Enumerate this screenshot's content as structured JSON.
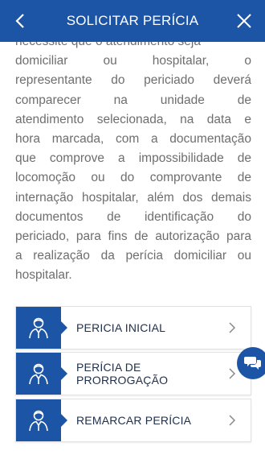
{
  "header": {
    "title": "SOLICITAR PERÍCIA",
    "back_icon": "chevron-left-icon",
    "close_icon": "close-icon"
  },
  "body": {
    "paragraph_lines": [
      "necessite que o atendimento seja",
      "domiciliar ou hospitalar, o",
      "representante do periciado deverá",
      "comparecer na unidade de",
      "atendimento selecionada, na data e",
      "hora marcada, com a documentação",
      "que comprove a impossibilidade de",
      "locomoção ou do comprovante de",
      "internação hospitalar, além dos demais",
      "documentos de identificação do",
      "periciado, para fins de autorização para",
      "a realização da perícia domiciliar ou",
      "hospitalar."
    ]
  },
  "options": [
    {
      "label": "PERICIA INICIAL",
      "icon": "person-icon"
    },
    {
      "label": "PERÍCIA DE PRORROGAÇÃO",
      "icon": "person-icon"
    },
    {
      "label": "REMARCAR PERÍCIA",
      "icon": "person-icon"
    }
  ],
  "chat_button": {
    "icon": "chat-bubbles-icon"
  },
  "colors": {
    "primary": "#1c55a6",
    "text": "#6e6e6e",
    "option_text": "#1f2f4a"
  }
}
